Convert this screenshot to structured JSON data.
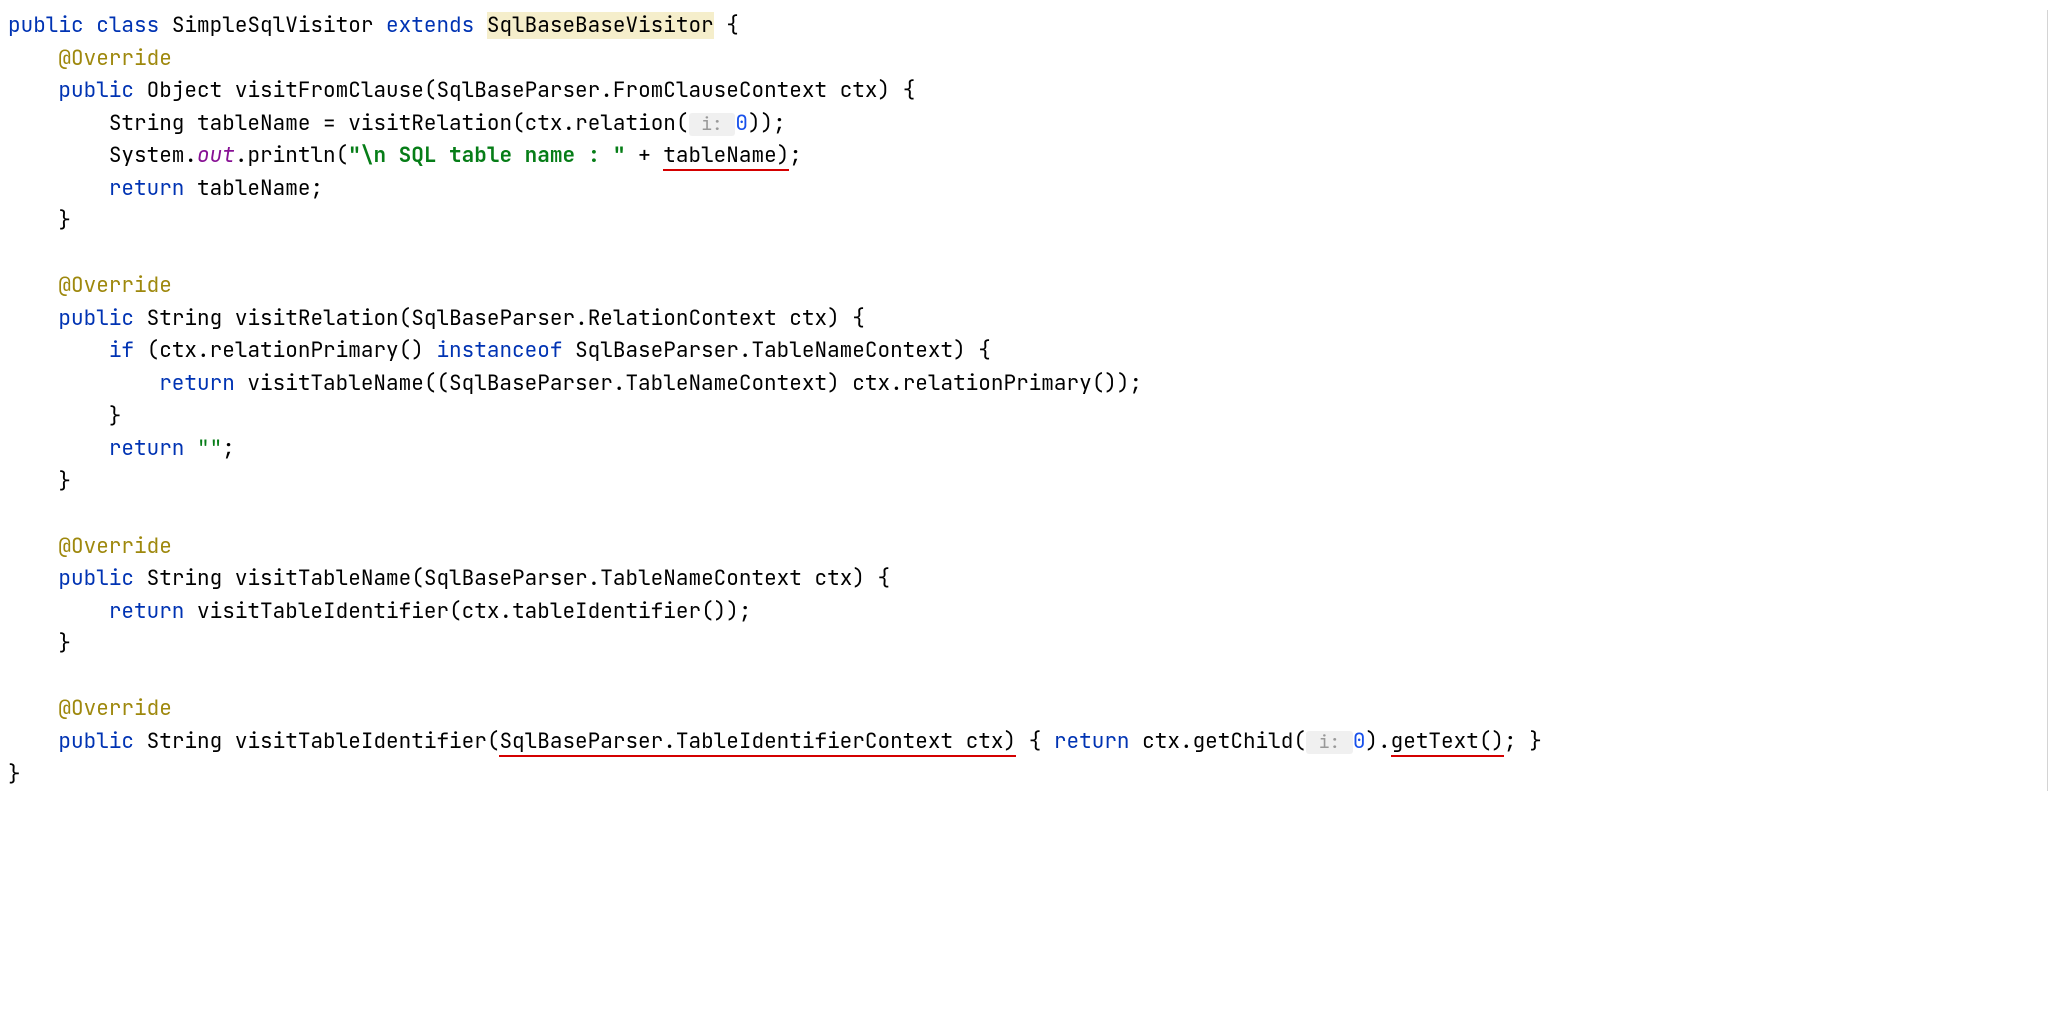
{
  "tokens": {
    "public": "public",
    "class": "class",
    "extends": "extends",
    "return": "return",
    "if": "if",
    "instanceof": "instanceof",
    "override": "@Override",
    "className": "SimpleSqlVisitor",
    "baseClass": "SqlBaseBaseVisitor",
    "object": "Object",
    "string": "String",
    "visitFromClause": "visitFromClause",
    "visitRelation": "visitRelation",
    "visitTableName": "visitTableName",
    "visitTableIdentifier": "visitTableIdentifier",
    "sqlBaseParser": "SqlBaseParser",
    "fromClauseContext": "FromClauseContext",
    "relationContext": "RelationContext",
    "tableNameContext": "TableNameContext",
    "tableIdentifierContext": "TableIdentifierContext",
    "ctx": "ctx",
    "tableName": "tableName",
    "relation": "relation",
    "relationPrimary": "relationPrimary",
    "tableIdentifier": "tableIdentifier",
    "getChild": "getChild",
    "getText": "getText",
    "system": "System",
    "out": "out",
    "println": "println",
    "stringLiteral1": "\"\\n SQL table name : \"",
    "emptyString": "\"\"",
    "paramHint": " i: ",
    "zero": "0"
  }
}
